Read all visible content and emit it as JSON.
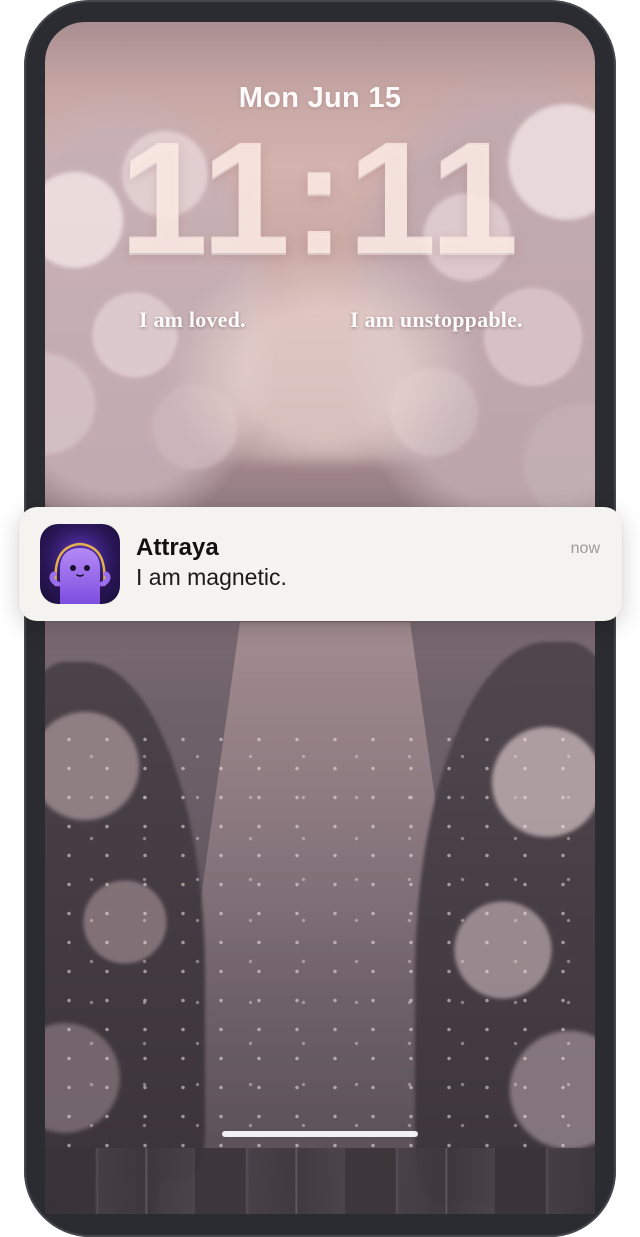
{
  "lock_screen": {
    "date": "Mon Jun 15",
    "time": "11:11",
    "widgets": [
      "I am loved.",
      "I am unstoppable."
    ]
  },
  "notification": {
    "app_name": "Attraya",
    "message": "I am magnetic.",
    "timestamp": "now",
    "icon": "attraya-app-icon"
  },
  "colors": {
    "notification_bg": "#f5f3ef",
    "app_icon_bg": "#2a1758",
    "mascot": "#9b6ef0",
    "halo": "#f5c04a"
  }
}
